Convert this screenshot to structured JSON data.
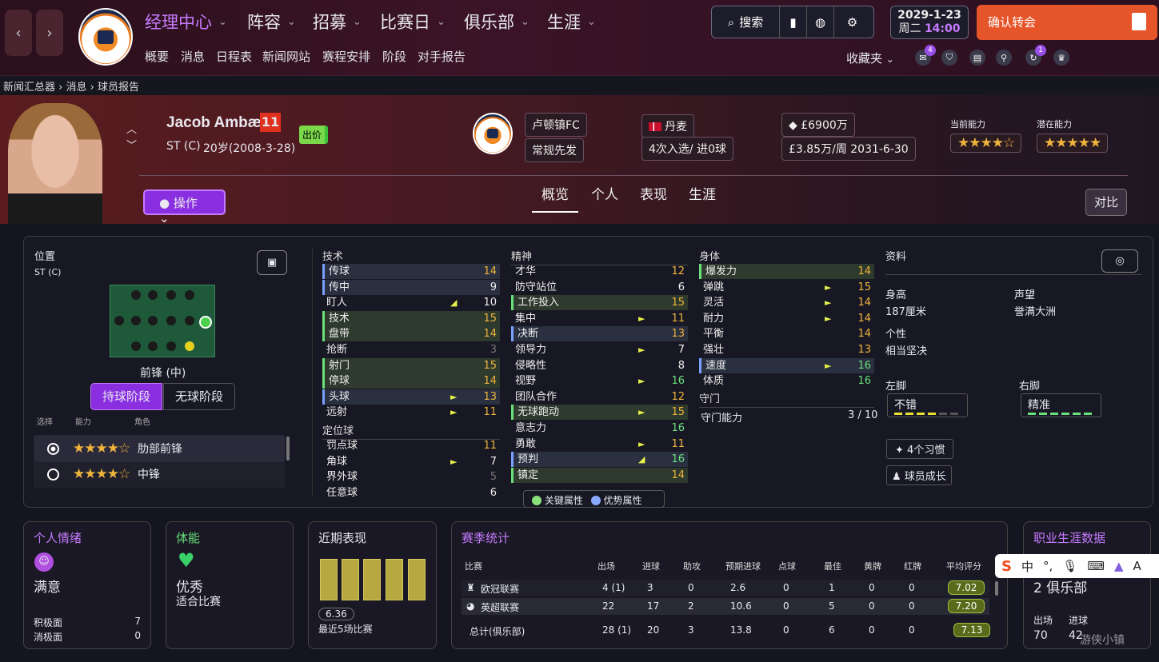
{
  "nav": {
    "back": "‹",
    "forward": "›",
    "club_crest": "LUTON TOWN FOOTBALL CLUB"
  },
  "menu": [
    {
      "label": "经理中心",
      "active": true
    },
    {
      "label": "阵容"
    },
    {
      "label": "招募"
    },
    {
      "label": "比赛日"
    },
    {
      "label": "俱乐部"
    },
    {
      "label": "生涯"
    }
  ],
  "submenu": [
    "概要",
    "消息",
    "日程表",
    "新闻网站",
    "赛程安排",
    "阶段",
    "对手报告"
  ],
  "toolbar": {
    "search_label": "搜索",
    "date": "2029-1-23",
    "weekday": "周二",
    "time": "14:00",
    "confirm_label": "确认转会",
    "favorites": "收藏夹",
    "chat_badge": "4",
    "refresh_badge": "1"
  },
  "breadcrumb": [
    "新闻汇总器",
    "消息",
    "球员报告"
  ],
  "player": {
    "name": "Jacob Ambæk",
    "number": "11",
    "position": "ST (C)",
    "age": "20岁(2008-3-28)",
    "bid_label": "出价",
    "club": "卢顿镇FC",
    "role": "常规先发",
    "nation": "丹麦",
    "caps": "4次入选/ 进0球",
    "value": "£6900万",
    "wage": "£3.85万/周",
    "contract": "2031-6-30",
    "current_ability_label": "当前能力",
    "potential_ability_label": "潜在能力",
    "current_stars": "★★★★☆",
    "potential_stars": "★★★★★",
    "action_label": "操作",
    "compare_label": "对比"
  },
  "tabs": [
    "概览",
    "个人",
    "表现",
    "生涯"
  ],
  "position_panel": {
    "title": "位置",
    "pos": "ST (C)",
    "role_name": "前锋 (中)",
    "phase_in": "持球阶段",
    "phase_out": "无球阶段",
    "col_select": "选择",
    "col_ability": "能力",
    "col_role": "角色",
    "roles": [
      {
        "stars": "★★★★☆",
        "name": "肋部前锋",
        "selected": true
      },
      {
        "stars": "★★★★☆",
        "name": "中锋",
        "selected": false
      }
    ]
  },
  "technical": {
    "title": "技术",
    "items": [
      {
        "n": "传球",
        "v": "14",
        "c": "o",
        "h": "bl"
      },
      {
        "n": "传中",
        "v": "9",
        "c": "w",
        "h": "bl"
      },
      {
        "n": "盯人",
        "v": "10",
        "c": "w",
        "h": "",
        "a": "up"
      },
      {
        "n": "技术",
        "v": "15",
        "c": "o",
        "h": "hl"
      },
      {
        "n": "盘带",
        "v": "14",
        "c": "o",
        "h": "hl"
      },
      {
        "n": "抢断",
        "v": "3",
        "c": "gr",
        "h": ""
      },
      {
        "n": "射门",
        "v": "15",
        "c": "o",
        "h": "hl"
      },
      {
        "n": "停球",
        "v": "14",
        "c": "o",
        "h": "hl"
      },
      {
        "n": "头球",
        "v": "13",
        "c": "o",
        "h": "bl",
        "a": "r"
      },
      {
        "n": "远射",
        "v": "11",
        "c": "o",
        "h": "",
        "a": "r"
      }
    ]
  },
  "setpieces": {
    "title": "定位球",
    "items": [
      {
        "n": "罚点球",
        "v": "11",
        "c": "o"
      },
      {
        "n": "角球",
        "v": "7",
        "c": "w",
        "a": "r"
      },
      {
        "n": "界外球",
        "v": "5",
        "c": "gr"
      },
      {
        "n": "任意球",
        "v": "6",
        "c": "w"
      }
    ]
  },
  "mental": {
    "title": "精神",
    "items": [
      {
        "n": "才华",
        "v": "12",
        "c": "o",
        "h": ""
      },
      {
        "n": "防守站位",
        "v": "6",
        "c": "w",
        "h": ""
      },
      {
        "n": "工作投入",
        "v": "15",
        "c": "o",
        "h": "hl"
      },
      {
        "n": "集中",
        "v": "11",
        "c": "o",
        "h": "",
        "a": "r"
      },
      {
        "n": "决断",
        "v": "13",
        "c": "o",
        "h": "bl"
      },
      {
        "n": "领导力",
        "v": "7",
        "c": "w",
        "h": "",
        "a": "r"
      },
      {
        "n": "侵略性",
        "v": "8",
        "c": "w",
        "h": ""
      },
      {
        "n": "视野",
        "v": "16",
        "c": "g",
        "h": "",
        "a": "r"
      },
      {
        "n": "团队合作",
        "v": "12",
        "c": "o",
        "h": ""
      },
      {
        "n": "无球跑动",
        "v": "15",
        "c": "o",
        "h": "hl",
        "a": "r"
      },
      {
        "n": "意志力",
        "v": "16",
        "c": "g",
        "h": ""
      },
      {
        "n": "勇敢",
        "v": "11",
        "c": "o",
        "h": "",
        "a": "r"
      },
      {
        "n": "预判",
        "v": "16",
        "c": "g",
        "h": "bl",
        "a": "up"
      },
      {
        "n": "镇定",
        "v": "14",
        "c": "o",
        "h": "hl"
      }
    ]
  },
  "physical": {
    "title": "身体",
    "items": [
      {
        "n": "爆发力",
        "v": "14",
        "c": "o",
        "h": "hl"
      },
      {
        "n": "弹跳",
        "v": "15",
        "c": "o",
        "h": "",
        "a": "r"
      },
      {
        "n": "灵活",
        "v": "14",
        "c": "o",
        "h": "",
        "a": "r"
      },
      {
        "n": "耐力",
        "v": "14",
        "c": "o",
        "h": "",
        "a": "r"
      },
      {
        "n": "平衡",
        "v": "14",
        "c": "o",
        "h": ""
      },
      {
        "n": "强壮",
        "v": "13",
        "c": "o",
        "h": ""
      },
      {
        "n": "速度",
        "v": "16",
        "c": "g",
        "h": "bl",
        "a": "r"
      },
      {
        "n": "体质",
        "v": "16",
        "c": "g",
        "h": ""
      }
    ]
  },
  "goalkeeping": {
    "title": "守门",
    "label": "守门能力",
    "value": "3 / 10"
  },
  "legend": {
    "key": "关键属性",
    "strong": "优势属性"
  },
  "info": {
    "title": "资料",
    "height_label": "身高",
    "height": "187厘米",
    "rep_label": "声望",
    "rep": "誉满大洲",
    "personality_label": "个性",
    "personality": "相当坚决",
    "left_foot_label": "左脚",
    "left_foot": "不错",
    "right_foot_label": "右脚",
    "right_foot": "精准",
    "habits": "4个习惯",
    "growth": "球员成长"
  },
  "morale": {
    "title": "个人情绪",
    "state": "满意",
    "pos_label": "积极面",
    "pos": "7",
    "neg_label": "消极面",
    "neg": "0"
  },
  "fitness": {
    "title": "体能",
    "state": "优秀",
    "sub": "适合比赛"
  },
  "form": {
    "title": "近期表现",
    "avg": "6.36",
    "caption": "最近5场比赛"
  },
  "season": {
    "title": "赛季统计",
    "headers": [
      "比赛",
      "出场",
      "进球",
      "助攻",
      "预期进球",
      "点球",
      "最佳",
      "黄牌",
      "红牌",
      "平均评分"
    ],
    "rows": [
      [
        "欧冠联赛",
        "4 (1)",
        "3",
        "0",
        "2.6",
        "0",
        "1",
        "0",
        "0",
        "7.02"
      ],
      [
        "英超联赛",
        "22",
        "17",
        "2",
        "10.6",
        "0",
        "5",
        "0",
        "0",
        "7.20"
      ]
    ],
    "total": [
      "总计(俱乐部)",
      "28 (1)",
      "20",
      "3",
      "13.8",
      "0",
      "6",
      "0",
      "0",
      "7.13"
    ]
  },
  "career": {
    "title": "职业生涯数据",
    "clubs": "2 俱乐部",
    "apps_label": "出场",
    "apps": "70",
    "goals_label": "进球",
    "goals": "42"
  },
  "ime": {
    "lang": "中",
    "punct": "°,"
  },
  "watermark": "游侠小镇"
}
